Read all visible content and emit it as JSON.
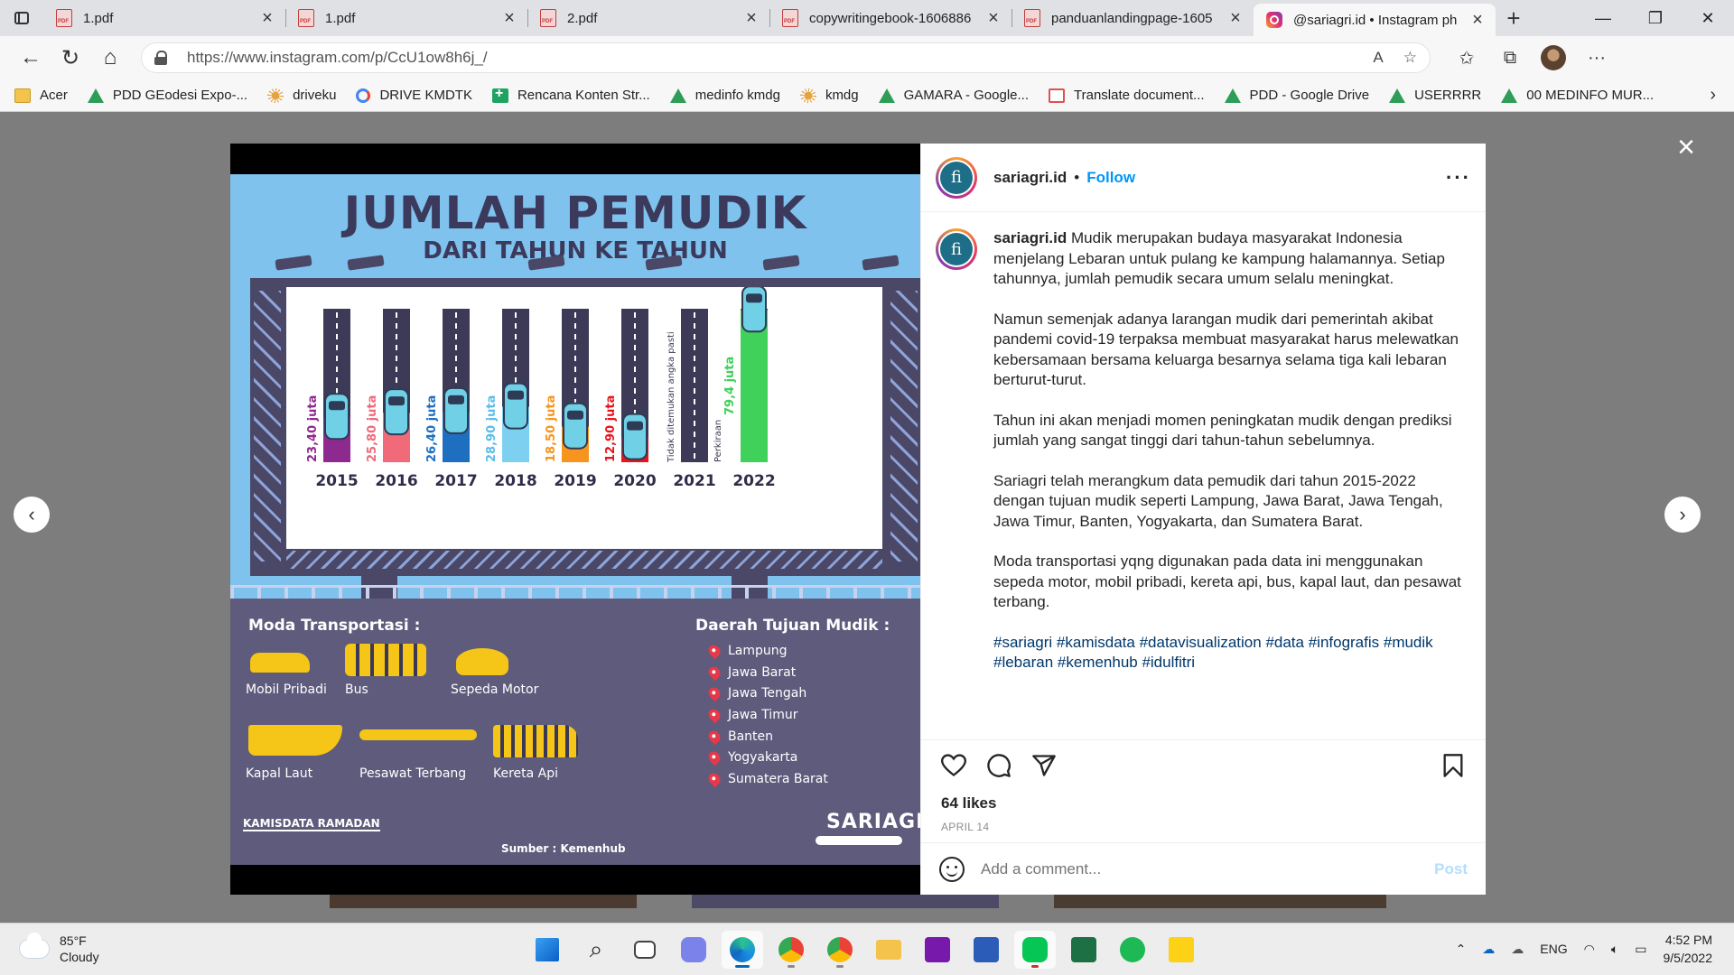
{
  "browser": {
    "tabs": [
      {
        "title": "1.pdf",
        "icon": "pdf-icon",
        "active": false
      },
      {
        "title": "1.pdf",
        "icon": "pdf-icon",
        "active": false
      },
      {
        "title": "2.pdf",
        "icon": "pdf-icon",
        "active": false
      },
      {
        "title": "copywritingebook-1606886",
        "icon": "pdf-icon",
        "active": false
      },
      {
        "title": "panduanlandingpage-1605",
        "icon": "pdf-icon",
        "active": false
      },
      {
        "title": "@sariagri.id • Instagram ph",
        "icon": "instagram-icon",
        "active": true
      }
    ],
    "url": "https://www.instagram.com/p/CcU1ow8h6j_/",
    "bookmarks": [
      {
        "label": "Acer",
        "icon": "folder-icon"
      },
      {
        "label": "PDD GEodesi Expo-...",
        "icon": "drive-icon"
      },
      {
        "label": "driveku",
        "icon": "sun-icon"
      },
      {
        "label": "DRIVE KMDTK",
        "icon": "google-icon"
      },
      {
        "label": "Rencana Konten Str...",
        "icon": "sheets-icon"
      },
      {
        "label": "medinfo kmdg",
        "icon": "drive-icon"
      },
      {
        "label": "kmdg",
        "icon": "sun-icon"
      },
      {
        "label": "GAMARA - Google...",
        "icon": "drive-icon"
      },
      {
        "label": "Translate document...",
        "icon": "translate-icon"
      },
      {
        "label": "PDD - Google Drive",
        "icon": "drive-icon"
      },
      {
        "label": "USERRRR",
        "icon": "drive-icon"
      },
      {
        "label": "00 MEDINFO MUR...",
        "icon": "drive-icon"
      }
    ]
  },
  "infographic": {
    "title": "JUMLAH PEMUDIK",
    "subtitle": "DARI TAHUN KE TAHUN",
    "transport_heading": "Moda Transportasi :",
    "transport": [
      "Mobil Pribadi",
      "Bus",
      "Sepeda Motor",
      "Kapal Laut",
      "Pesawat Terbang",
      "Kereta Api"
    ],
    "destination_heading": "Daerah Tujuan Mudik :",
    "destinations": [
      "Lampung",
      "Jawa Barat",
      "Jawa Tengah",
      "Jawa Timur",
      "Banten",
      "Yogyakarta",
      "Sumatera Barat"
    ],
    "source": "Sumber : Kemenhub",
    "brand_left": "KAMISDATA RAMADAN",
    "brand_right": "SARIAGRI"
  },
  "chart_data": {
    "type": "bar",
    "categories": [
      "2015",
      "2016",
      "2017",
      "2018",
      "2019",
      "2020",
      "2021",
      "2022"
    ],
    "values": [
      23.4,
      25.8,
      26.4,
      28.9,
      18.5,
      12.9,
      null,
      79.4
    ],
    "value_labels": [
      "23,40 juta",
      "25,80 juta",
      "26,40 juta",
      "28,90 juta",
      "18,50 juta",
      "12,90 juta",
      "Tidak ditemukan angka pasti",
      "79,4 juta"
    ],
    "extra_labels": [
      "",
      "",
      "",
      "",
      "",
      "",
      "",
      "Perkiraan"
    ],
    "colors": [
      "#8e2a8f",
      "#f06a7a",
      "#1f6fc0",
      "#7dd0f0",
      "#f7941d",
      "#e8131b",
      "#3c3a56",
      "#3fd15a"
    ],
    "ylim": [
      0,
      80
    ]
  },
  "post": {
    "username": "sariagri.id",
    "follow_label": "Follow",
    "caption_paragraphs": [
      "Mudik merupakan budaya masyarakat Indonesia menjelang Lebaran untuk pulang ke kampung halamannya. Setiap tahunnya, jumlah pemudik secara umum selalu meningkat.",
      "Namun semenjak adanya larangan mudik dari pemerintah akibat pandemi covid-19 terpaksa membuat masyarakat harus melewatkan kebersamaan bersama keluarga besarnya selama tiga kali lebaran berturut-turut.",
      "Tahun ini akan menjadi momen peningkatan mudik dengan prediksi jumlah yang sangat tinggi dari tahun-tahun sebelumnya.",
      "Sariagri telah merangkum data pemudik dari tahun 2015-2022 dengan tujuan mudik seperti Lampung, Jawa Barat, Jawa Tengah, Jawa Timur, Banten, Yogyakarta, dan Sumatera Barat.",
      "Moda transportasi yqng digunakan pada data ini menggunakan sepeda motor, mobil pribadi, kereta api, bus, kapal laut, dan pesawat terbang."
    ],
    "hashtags": "#sariagri #kamisdata #datavisualization #data #infografis #mudik #lebaran #kemenhub #idulfitri",
    "likes": "64 likes",
    "date": "APRIL 14",
    "comment_placeholder": "Add a comment...",
    "post_button": "Post"
  },
  "taskbar": {
    "temperature": "85°F",
    "weather": "Cloudy",
    "language": "ENG",
    "time": "4:52 PM",
    "date": "9/5/2022"
  }
}
